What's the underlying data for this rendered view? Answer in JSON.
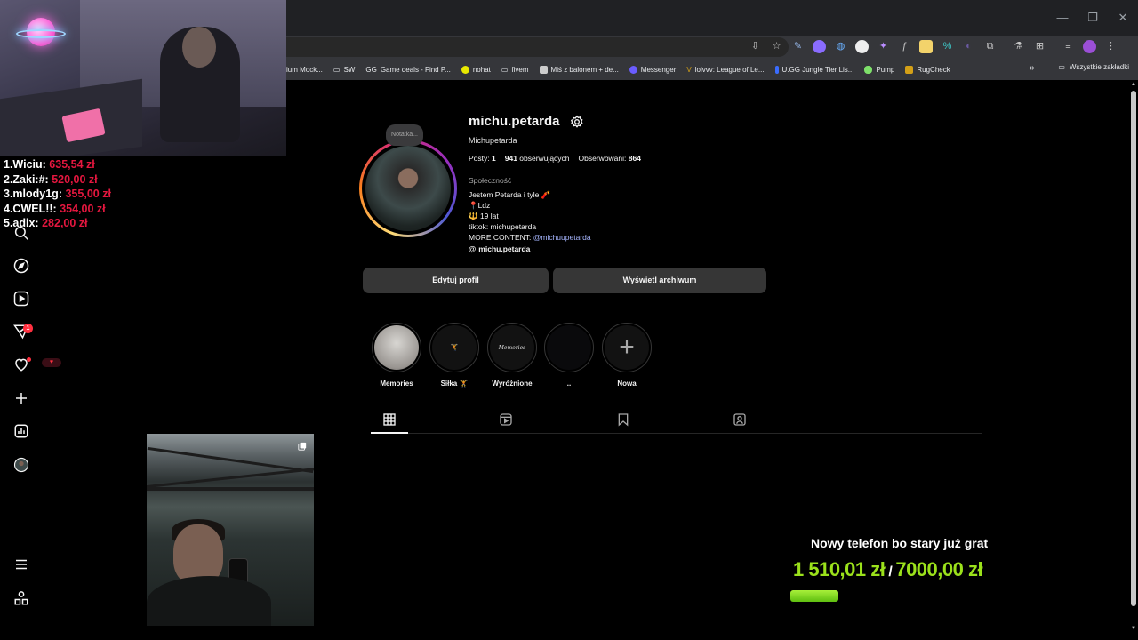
{
  "browser": {
    "window_controls": [
      "—",
      "❐",
      "✕"
    ],
    "bookmarks": [
      {
        "label": "ium Mock...",
        "color": "#888888"
      },
      {
        "label": "SW",
        "color": "#9aa0a6"
      },
      {
        "label": "Game deals - Find P...",
        "color": "#dddddd"
      },
      {
        "label": "nohat",
        "color": "#e8e800"
      },
      {
        "label": "fivem",
        "color": "#9aa0a6"
      },
      {
        "label": "Miś z balonem + de...",
        "color": "#cccccc"
      },
      {
        "label": "Messenger",
        "color": "#6a5cff"
      },
      {
        "label": "lolvvv: League of Le...",
        "color": "#d4a017"
      },
      {
        "label": "U.GG Jungle Tier Lis...",
        "color": "#3a6cff"
      },
      {
        "label": "Pump",
        "color": "#7ee06a"
      },
      {
        "label": "RugCheck",
        "color": "#d4a017"
      }
    ],
    "bookmarks_more": "»",
    "all_bookmarks": "Wszystkie zakładki"
  },
  "leaderboard": [
    {
      "rank_name": "1.Wiciu:",
      "amount": "635,54 zł"
    },
    {
      "rank_name": "2.Zaki:#:",
      "amount": "520,00 zł"
    },
    {
      "rank_name": "3.mlody1g:",
      "amount": "355,00 zł"
    },
    {
      "rank_name": "4.CWEL!!:",
      "amount": "354,00 zł"
    },
    {
      "rank_name": "5.adix:",
      "amount": "282,00 zł"
    }
  ],
  "sidebar": {
    "icons": [
      "home-icon",
      "search-icon",
      "explore-icon",
      "reels-icon",
      "messages-icon",
      "notifications-icon",
      "create-icon",
      "dashboard-icon",
      "profile-icon",
      "menu-icon",
      "more-icon"
    ],
    "messages_badge": "1",
    "notifications_pill": "♥"
  },
  "profile": {
    "note": "Notatka...",
    "username": "michu.petarda",
    "full_name": "Michupetarda",
    "posts_label": "Posty:",
    "posts_count": "1",
    "followers_count": "941",
    "followers_label": "obserwujących",
    "following_label": "Obserwowani:",
    "following_count": "864",
    "category": "Społeczność",
    "bio_line1": "Jestem Petarda i tyle 🧨",
    "bio_line2": "📍Ldz",
    "bio_line3": "🔱 19 lat",
    "bio_line4": "tiktok: michupetarda",
    "bio_line5_prefix": "MORE CONTENT: ",
    "bio_line5_link": "@michuupetarda",
    "threads_handle": "michu.petarda"
  },
  "buttons": {
    "edit_profile": "Edytuj profil",
    "view_archive": "Wyświetl archiwum"
  },
  "highlights": [
    {
      "label": "Memories",
      "inner": ""
    },
    {
      "label": "Siłka 🏋",
      "inner": "🏋"
    },
    {
      "label": "Wyróżnione",
      "inner": "Memories"
    },
    {
      "label": "..",
      "inner": ""
    },
    {
      "label": "Nowa",
      "inner": "+"
    }
  ],
  "tabs": [
    "posts-grid-icon",
    "reels-tab-icon",
    "saved-tab-icon",
    "tagged-tab-icon"
  ],
  "goal": {
    "title": "Nowy telefon bo stary już grat",
    "current": "1 510,01 zł",
    "separator": "/",
    "target": "7000,00 zł",
    "progress_fraction": 0.2157,
    "bar_color": "#7ad11f"
  }
}
